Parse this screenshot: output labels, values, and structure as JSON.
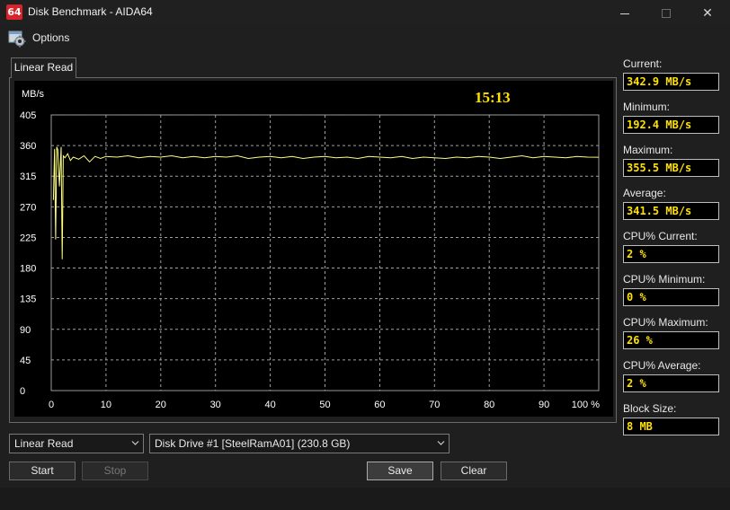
{
  "window": {
    "icon_text": "64",
    "title": "Disk Benchmark - AIDA64"
  },
  "menu": {
    "options_label": "Options"
  },
  "tab": {
    "label": "Linear Read"
  },
  "graph": {
    "time": "15:13",
    "y_unit": "MB/s",
    "y_ticks": [
      "0",
      "45",
      "90",
      "135",
      "180",
      "225",
      "270",
      "315",
      "360",
      "405"
    ],
    "x_ticks": [
      "0",
      "10",
      "20",
      "30",
      "40",
      "50",
      "60",
      "70",
      "80",
      "90",
      "100 %"
    ],
    "line_color": "#ffff80",
    "time_color": "#ffe000"
  },
  "chart_data": {
    "type": "line",
    "xlabel": "",
    "ylabel": "MB/s",
    "xlim": [
      0,
      100
    ],
    "ylim": [
      0,
      405
    ],
    "grid": true,
    "series": [
      {
        "x": [
          0.4,
          0.6,
          0.8,
          1.0,
          1.2,
          1.5,
          1.8,
          2.0,
          2.2,
          2.5,
          3.0,
          3.5,
          4.0,
          5,
          6,
          7,
          8,
          9,
          10,
          12,
          14,
          16,
          18,
          20,
          22,
          24,
          26,
          28,
          30,
          32,
          34,
          36,
          38,
          40,
          42,
          44,
          46,
          48,
          50,
          52,
          54,
          56,
          58,
          60,
          62,
          64,
          66,
          68,
          70,
          72,
          74,
          76,
          78,
          80,
          82,
          84,
          86,
          88,
          90,
          92,
          94,
          96,
          98,
          100
        ],
        "y": [
          280,
          355,
          222,
          358,
          354,
          300,
          358,
          193,
          345,
          342,
          348,
          338,
          343,
          340,
          345,
          336,
          344,
          341,
          344,
          343,
          345,
          342,
          344,
          343,
          345,
          342,
          344,
          342,
          344,
          343,
          345,
          341,
          343,
          344,
          342,
          344,
          341,
          343,
          344,
          342,
          343,
          341,
          344,
          343,
          342,
          344,
          341,
          343,
          342,
          341,
          343,
          342,
          344,
          343,
          341,
          343,
          345,
          342,
          344,
          343,
          342,
          344,
          343,
          342.9
        ]
      }
    ]
  },
  "stats": [
    {
      "label": "Current:",
      "value": "342.9 MB/s"
    },
    {
      "label": "Minimum:",
      "value": "192.4 MB/s"
    },
    {
      "label": "Maximum:",
      "value": "355.5 MB/s"
    },
    {
      "label": "Average:",
      "value": "341.5 MB/s"
    },
    {
      "label": "CPU% Current:",
      "value": "2 %"
    },
    {
      "label": "CPU% Minimum:",
      "value": "0 %"
    },
    {
      "label": "CPU% Maximum:",
      "value": "26 %"
    },
    {
      "label": "CPU% Average:",
      "value": "2 %"
    },
    {
      "label": "Block Size:",
      "value": "8 MB"
    }
  ],
  "controls": {
    "test_select": "Linear Read",
    "drive_select": "Disk Drive #1  [SteelRamA01]  (230.8 GB)",
    "start": "Start",
    "stop": "Stop",
    "save": "Save",
    "clear": "Clear"
  }
}
